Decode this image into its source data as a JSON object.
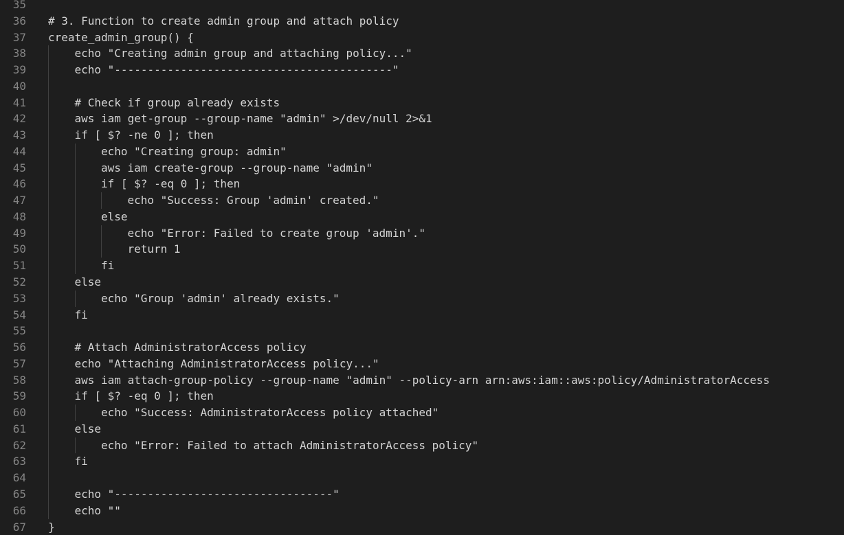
{
  "editor": {
    "lines": [
      {
        "number": "35",
        "text": "",
        "indent": 0
      },
      {
        "number": "36",
        "text": "# 3. Function to create admin group and attach policy",
        "indent": 0
      },
      {
        "number": "37",
        "text": "create_admin_group() {",
        "indent": 0
      },
      {
        "number": "38",
        "text": "echo \"Creating admin group and attaching policy...\"",
        "indent": 1
      },
      {
        "number": "39",
        "text": "echo \"------------------------------------------\"",
        "indent": 1
      },
      {
        "number": "40",
        "text": "",
        "indent": 0
      },
      {
        "number": "41",
        "text": "# Check if group already exists",
        "indent": 1
      },
      {
        "number": "42",
        "text": "aws iam get-group --group-name \"admin\" >/dev/null 2>&1",
        "indent": 1
      },
      {
        "number": "43",
        "text": "if [ $? -ne 0 ]; then",
        "indent": 1
      },
      {
        "number": "44",
        "text": "echo \"Creating group: admin\"",
        "indent": 2
      },
      {
        "number": "45",
        "text": "aws iam create-group --group-name \"admin\"",
        "indent": 2
      },
      {
        "number": "46",
        "text": "if [ $? -eq 0 ]; then",
        "indent": 2
      },
      {
        "number": "47",
        "text": "echo \"Success: Group 'admin' created.\"",
        "indent": 3
      },
      {
        "number": "48",
        "text": "else",
        "indent": 2
      },
      {
        "number": "49",
        "text": "echo \"Error: Failed to create group 'admin'.\"",
        "indent": 3
      },
      {
        "number": "50",
        "text": "return 1",
        "indent": 3
      },
      {
        "number": "51",
        "text": "fi",
        "indent": 2
      },
      {
        "number": "52",
        "text": "else",
        "indent": 1
      },
      {
        "number": "53",
        "text": "echo \"Group 'admin' already exists.\"",
        "indent": 2
      },
      {
        "number": "54",
        "text": "fi",
        "indent": 1
      },
      {
        "number": "55",
        "text": "",
        "indent": 0
      },
      {
        "number": "56",
        "text": "# Attach AdministratorAccess policy",
        "indent": 1
      },
      {
        "number": "57",
        "text": "echo \"Attaching AdministratorAccess policy...\"",
        "indent": 1
      },
      {
        "number": "58",
        "text": "aws iam attach-group-policy --group-name \"admin\" --policy-arn arn:aws:iam::aws:policy/AdministratorAccess",
        "indent": 1
      },
      {
        "number": "59",
        "text": "if [ $? -eq 0 ]; then",
        "indent": 1
      },
      {
        "number": "60",
        "text": "echo \"Success: AdministratorAccess policy attached\"",
        "indent": 2
      },
      {
        "number": "61",
        "text": "else",
        "indent": 1
      },
      {
        "number": "62",
        "text": "echo \"Error: Failed to attach AdministratorAccess policy\"",
        "indent": 2
      },
      {
        "number": "63",
        "text": "fi",
        "indent": 1
      },
      {
        "number": "64",
        "text": "",
        "indent": 0
      },
      {
        "number": "65",
        "text": "echo \"---------------------------------\"",
        "indent": 1
      },
      {
        "number": "66",
        "text": "echo \"\"",
        "indent": 1
      },
      {
        "number": "67",
        "text": "}",
        "indent": 0
      }
    ],
    "guides": [
      {
        "from": "38",
        "to": "66",
        "level": 1
      },
      {
        "from": "44",
        "to": "53",
        "level": 2
      },
      {
        "from": "47",
        "to": "50",
        "level": 3
      },
      {
        "from": "53",
        "to": "53",
        "level": 2
      },
      {
        "from": "60",
        "to": "60",
        "level": 2
      },
      {
        "from": "62",
        "to": "62",
        "level": 2
      }
    ]
  },
  "colors": {
    "background": "#1e1e1e",
    "text": "#d4d4d4",
    "line_number": "#858585",
    "indent_guide": "#404040"
  }
}
